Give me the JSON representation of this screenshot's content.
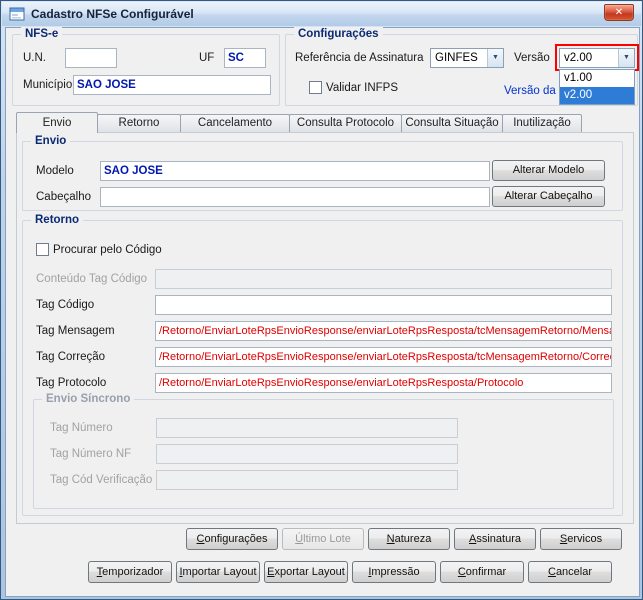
{
  "colors": {
    "caption_navy": "#0a2a75",
    "value_navy": "#0018b0",
    "value_red": "#e00000",
    "selection_blue": "#2f7cd6",
    "annotation_red": "#ff0000",
    "link_blue": "#0033cc"
  },
  "icons": {
    "close": "✕",
    "dropdown_arrow": "▼"
  },
  "window": {
    "title": "Cadastro NFSe Configurável"
  },
  "nfse": {
    "caption": "NFS-e",
    "un_label": "U.N.",
    "un_value": "",
    "uf_label": "UF",
    "uf_value": "SC",
    "municipio_label": "Município",
    "municipio_value": "SAO JOSE"
  },
  "configuracoes": {
    "caption": "Configurações",
    "referencia_assinatura_label": "Referência de Assinatura",
    "referencia_assinatura_value": "GINFES",
    "versao_label": "Versão",
    "versao_value": "v2.00",
    "validar_infps_label": "Validar INFPS",
    "validar_infps_checked": false,
    "versao_dll_label": "Versão da DLL",
    "versao_dropdown": {
      "options": [
        "v1.00",
        "v2.00"
      ],
      "selected_index": 1
    }
  },
  "tabs": [
    {
      "label": "Envio",
      "active": true
    },
    {
      "label": "Retorno",
      "active": false
    },
    {
      "label": "Cancelamento",
      "active": false
    },
    {
      "label": "Consulta Protocolo",
      "active": false
    },
    {
      "label": "Consulta Situação",
      "active": false
    },
    {
      "label": "Inutilização",
      "active": false
    }
  ],
  "envio": {
    "caption": "Envio",
    "modelo_label": "Modelo",
    "modelo_value": "SAO JOSE",
    "cabecalho_label": "Cabeçalho",
    "cabecalho_value": "",
    "alterar_modelo_button": "Alterar Modelo",
    "alterar_cabecalho_button": "Alterar Cabeçalho"
  },
  "retorno": {
    "caption": "Retorno",
    "procurar_codigo_label": "Procurar pelo Código",
    "procurar_codigo_checked": false,
    "conteudo_tag_codigo_label": "Conteúdo Tag Código",
    "conteudo_tag_codigo_value": "",
    "tag_codigo_label": "Tag Código",
    "tag_codigo_value": "",
    "tag_mensagem_label": "Tag Mensagem",
    "tag_mensagem_value": "/Retorno/EnviarLoteRpsEnvioResponse/enviarLoteRpsResposta/tcMensagemRetorno/Mensag",
    "tag_correcao_label": "Tag Correção",
    "tag_correcao_value": "/Retorno/EnviarLoteRpsEnvioResponse/enviarLoteRpsResposta/tcMensagemRetorno/Correca",
    "tag_protocolo_label": "Tag Protocolo",
    "tag_protocolo_value": "/Retorno/EnviarLoteRpsEnvioResponse/enviarLoteRpsResposta/Protocolo",
    "envio_sincrono": {
      "caption": "Envio Síncrono",
      "tag_numero_label": "Tag Número",
      "tag_numero_value": "",
      "tag_numero_nf_label": "Tag Número NF",
      "tag_numero_nf_value": "",
      "tag_cod_verificacao_label": "Tag Cód Verificação",
      "tag_cod_verificacao_value": ""
    }
  },
  "actions_row1": [
    {
      "label": "Configurações",
      "enabled": true
    },
    {
      "label": "Último Lote",
      "enabled": false
    },
    {
      "label": "Natureza",
      "enabled": true
    },
    {
      "label": "Assinatura",
      "enabled": true
    },
    {
      "label": "Servicos",
      "enabled": true
    }
  ],
  "actions_row2": [
    {
      "label": "Temporizador"
    },
    {
      "label": "Importar Layout"
    },
    {
      "label": "Exportar Layout"
    },
    {
      "label": "Impressão"
    },
    {
      "label": "Confirmar"
    },
    {
      "label": "Cancelar"
    }
  ]
}
